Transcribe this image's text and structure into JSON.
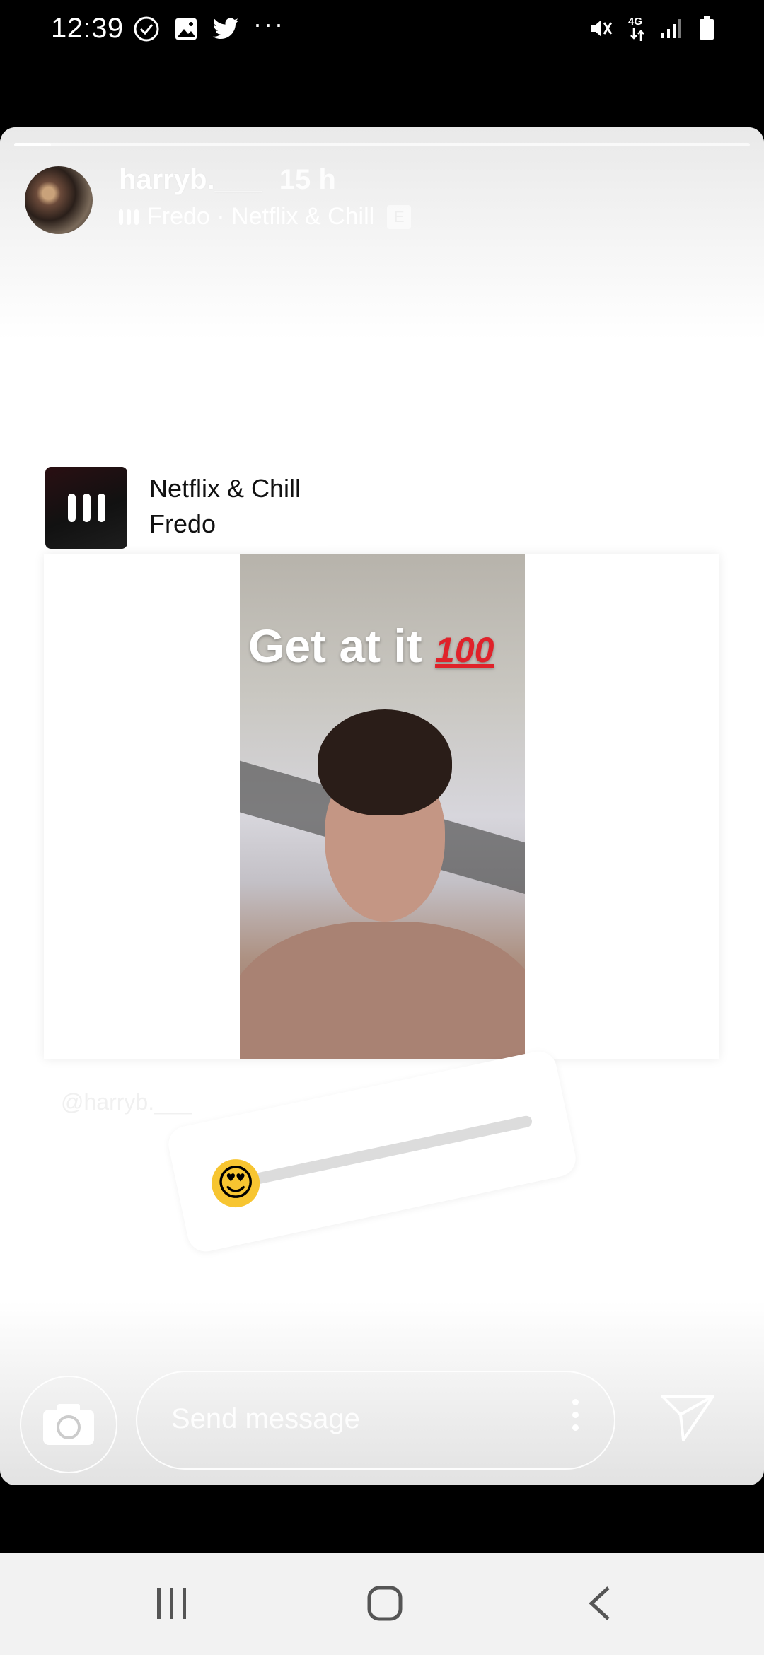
{
  "status_bar": {
    "time": "12:39",
    "left_icons": [
      "check-circle-icon",
      "image-icon",
      "twitter-icon"
    ],
    "more": "···",
    "right_icons": [
      "mute-icon",
      "4g-icon",
      "signal-icon",
      "battery-icon"
    ],
    "network": "4G"
  },
  "story": {
    "progress_fraction": 0.05,
    "username": "harryb.___",
    "time_ago": "15 h",
    "music_line": "Fredo · Netflix & Chill",
    "explicit_badge": "E"
  },
  "music_sticker": {
    "song_title": "Netflix & Chill",
    "artist": "Fredo"
  },
  "shared_post": {
    "caption": "Get at it",
    "caption_emoji": "100",
    "attribution": "@harryb.___"
  },
  "emoji_slider": {
    "emoji": "😍",
    "value_fraction": 0.0
  },
  "footer": {
    "message_placeholder": "Send message"
  },
  "colors": {
    "accent_red": "#e0222a",
    "story_bg": "#ffffff",
    "nav_bg": "#f2f2f2"
  }
}
